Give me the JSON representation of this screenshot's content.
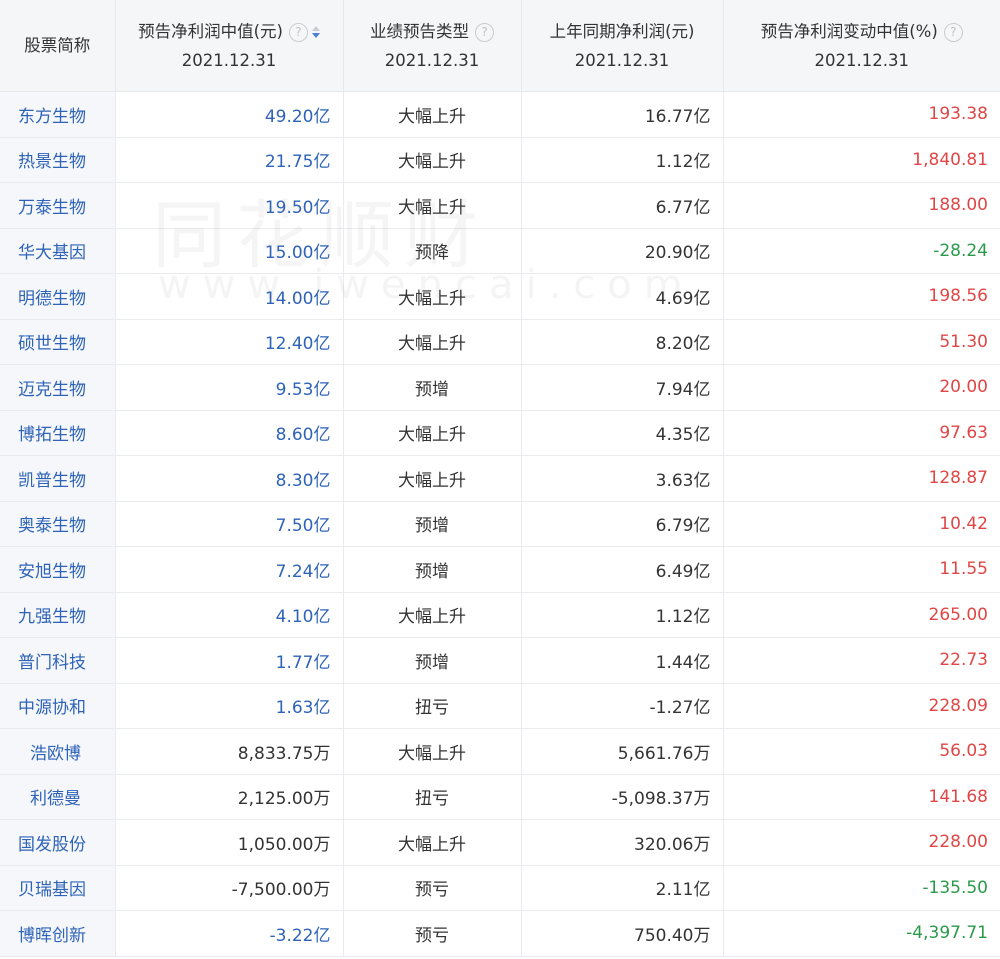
{
  "headers": {
    "col1": "股票简称",
    "col2_title": "预告净利润中值(元)",
    "col2_date": "2021.12.31",
    "col3_title": "业绩预告类型",
    "col3_date": "2021.12.31",
    "col4_title": "上年同期净利润(元)",
    "col4_date": "2021.12.31",
    "col5_title": "预告净利润变动中值(%)",
    "col5_date": "2021.12.31",
    "hint_symbol": "?"
  },
  "watermark": {
    "line1": "同花顺财",
    "line2": "www.iwencai.com"
  },
  "rows": [
    {
      "name": "东方生物",
      "forecast": "49.20亿",
      "type": "大幅上升",
      "last": "16.77亿",
      "change": "193.38",
      "dir": "up"
    },
    {
      "name": "热景生物",
      "forecast": "21.75亿",
      "type": "大幅上升",
      "last": "1.12亿",
      "change": "1,840.81",
      "dir": "up"
    },
    {
      "name": "万泰生物",
      "forecast": "19.50亿",
      "type": "大幅上升",
      "last": "6.77亿",
      "change": "188.00",
      "dir": "up"
    },
    {
      "name": "华大基因",
      "forecast": "15.00亿",
      "type": "预降",
      "last": "20.90亿",
      "change": "-28.24",
      "dir": "down"
    },
    {
      "name": "明德生物",
      "forecast": "14.00亿",
      "type": "大幅上升",
      "last": "4.69亿",
      "change": "198.56",
      "dir": "up"
    },
    {
      "name": "硕世生物",
      "forecast": "12.40亿",
      "type": "大幅上升",
      "last": "8.20亿",
      "change": "51.30",
      "dir": "up"
    },
    {
      "name": "迈克生物",
      "forecast": "9.53亿",
      "type": "预增",
      "last": "7.94亿",
      "change": "20.00",
      "dir": "up"
    },
    {
      "name": "博拓生物",
      "forecast": "8.60亿",
      "type": "大幅上升",
      "last": "4.35亿",
      "change": "97.63",
      "dir": "up"
    },
    {
      "name": "凯普生物",
      "forecast": "8.30亿",
      "type": "大幅上升",
      "last": "3.63亿",
      "change": "128.87",
      "dir": "up"
    },
    {
      "name": "奥泰生物",
      "forecast": "7.50亿",
      "type": "预增",
      "last": "6.79亿",
      "change": "10.42",
      "dir": "up"
    },
    {
      "name": "安旭生物",
      "forecast": "7.24亿",
      "type": "预增",
      "last": "6.49亿",
      "change": "11.55",
      "dir": "up"
    },
    {
      "name": "九强生物",
      "forecast": "4.10亿",
      "type": "大幅上升",
      "last": "1.12亿",
      "change": "265.00",
      "dir": "up"
    },
    {
      "name": "普门科技",
      "forecast": "1.77亿",
      "type": "预增",
      "last": "1.44亿",
      "change": "22.73",
      "dir": "up"
    },
    {
      "name": "中源协和",
      "forecast": "1.63亿",
      "type": "扭亏",
      "last": "-1.27亿",
      "change": "228.09",
      "dir": "up"
    },
    {
      "name": "浩欧博",
      "forecast": "8,833.75万",
      "type": "大幅上升",
      "last": "5,661.76万",
      "change": "56.03",
      "dir": "up"
    },
    {
      "name": "利德曼",
      "forecast": "2,125.00万",
      "type": "扭亏",
      "last": "-5,098.37万",
      "change": "141.68",
      "dir": "up"
    },
    {
      "name": "国发股份",
      "forecast": "1,050.00万",
      "type": "大幅上升",
      "last": "320.06万",
      "change": "228.00",
      "dir": "up"
    },
    {
      "name": "贝瑞基因",
      "forecast": "-7,500.00万",
      "type": "预亏",
      "last": "2.11亿",
      "change": "-135.50",
      "dir": "down"
    },
    {
      "name": "博晖创新",
      "forecast": "-3.22亿",
      "type": "预亏",
      "last": "750.40万",
      "change": "-4,397.71",
      "dir": "down"
    }
  ]
}
